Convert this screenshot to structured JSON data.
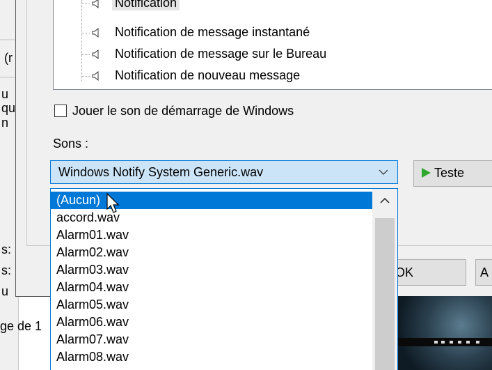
{
  "events": {
    "items": [
      {
        "label": "Notification",
        "selected": true
      },
      {
        "label": "Notification de message instantané",
        "selected": false
      },
      {
        "label": "Notification de message sur le Bureau",
        "selected": false
      },
      {
        "label": "Notification de nouveau message",
        "selected": false
      }
    ]
  },
  "startup_sound": {
    "label": "Jouer le son de démarrage de Windows",
    "checked": false
  },
  "sounds": {
    "label": "Sons :",
    "selected_value": "Windows Notify System Generic.wav",
    "test_label": "Teste",
    "dropdown_options": [
      "(Aucun)",
      "accord.wav",
      "Alarm01.wav",
      "Alarm02.wav",
      "Alarm03.wav",
      "Alarm04.wav",
      "Alarm05.wav",
      "Alarm06.wav",
      "Alarm07.wav",
      "Alarm08.wav"
    ],
    "highlighted_option": "(Aucun)"
  },
  "buttons": {
    "ok_label": "OK",
    "a_label": "A"
  },
  "background": {
    "left_fragments": [
      "(r",
      "u",
      "qu",
      "n",
      "s:",
      "s:",
      "u",
      "ge de 1"
    ]
  },
  "colors": {
    "accent": "#0078d7",
    "combo_bg": "#cce4f7",
    "dialog_bg": "#f0f0f0",
    "play_icon": "#2ea82e"
  }
}
